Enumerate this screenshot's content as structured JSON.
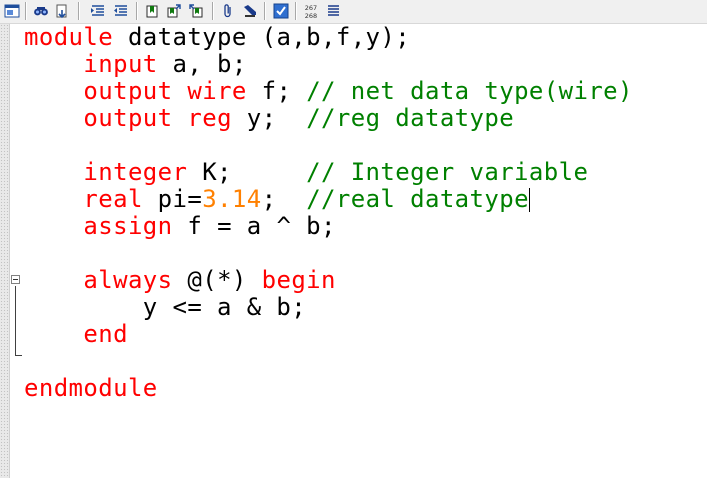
{
  "toolbar": {
    "line_counter": {
      "top": "267",
      "bottom": "268"
    },
    "icons": [
      "window-icon",
      "find-icon",
      "find-in-files-icon",
      "indent-icon",
      "outdent-icon",
      "bookmark-icon",
      "bookmark-next-icon",
      "bookmark-prev-icon",
      "attach-icon",
      "dropper-icon",
      "check-icon",
      "line-count-icon",
      "list-icon"
    ]
  },
  "colors": {
    "keyword": "#ff0000",
    "number": "#ff8000",
    "comment": "#008000",
    "identifier": "#000000"
  },
  "code": {
    "lines": [
      {
        "tokens": [
          {
            "t": "module",
            "c": "kw"
          },
          {
            "t": " datatype (a,b,f,y);",
            "c": "id"
          }
        ]
      },
      {
        "tokens": [
          {
            "t": "    ",
            "c": "id"
          },
          {
            "t": "input",
            "c": "kw"
          },
          {
            "t": " a, b;",
            "c": "id"
          }
        ]
      },
      {
        "tokens": [
          {
            "t": "    ",
            "c": "id"
          },
          {
            "t": "output",
            "c": "kw"
          },
          {
            "t": " ",
            "c": "id"
          },
          {
            "t": "wire",
            "c": "kw"
          },
          {
            "t": " f; ",
            "c": "id"
          },
          {
            "t": "// net data type(wire)",
            "c": "cm"
          }
        ]
      },
      {
        "tokens": [
          {
            "t": "    ",
            "c": "id"
          },
          {
            "t": "output",
            "c": "kw"
          },
          {
            "t": " ",
            "c": "id"
          },
          {
            "t": "reg",
            "c": "kw"
          },
          {
            "t": " y;  ",
            "c": "id"
          },
          {
            "t": "//reg datatype",
            "c": "cm"
          }
        ]
      },
      {
        "tokens": []
      },
      {
        "tokens": [
          {
            "t": "    ",
            "c": "id"
          },
          {
            "t": "integer",
            "c": "kw"
          },
          {
            "t": " K;     ",
            "c": "id"
          },
          {
            "t": "// Integer variable",
            "c": "cm"
          }
        ]
      },
      {
        "tokens": [
          {
            "t": "    ",
            "c": "id"
          },
          {
            "t": "real",
            "c": "kw"
          },
          {
            "t": " pi=",
            "c": "id"
          },
          {
            "t": "3.14",
            "c": "num"
          },
          {
            "t": ";  ",
            "c": "id"
          },
          {
            "t": "//real datatype",
            "c": "cm"
          }
        ],
        "caret": true
      },
      {
        "tokens": [
          {
            "t": "    ",
            "c": "id"
          },
          {
            "t": "assign",
            "c": "kw"
          },
          {
            "t": " f = a ^ b;",
            "c": "id"
          }
        ]
      },
      {
        "tokens": []
      },
      {
        "tokens": [
          {
            "t": "    ",
            "c": "id"
          },
          {
            "t": "always",
            "c": "kw"
          },
          {
            "t": " @(*) ",
            "c": "id"
          },
          {
            "t": "begin",
            "c": "kw"
          }
        ]
      },
      {
        "tokens": [
          {
            "t": "        y <= a & b;",
            "c": "id"
          }
        ]
      },
      {
        "tokens": [
          {
            "t": "    ",
            "c": "id"
          },
          {
            "t": "end",
            "c": "kw"
          }
        ]
      },
      {
        "tokens": []
      },
      {
        "tokens": [
          {
            "t": "endmodule",
            "c": "kw"
          }
        ]
      }
    ]
  }
}
